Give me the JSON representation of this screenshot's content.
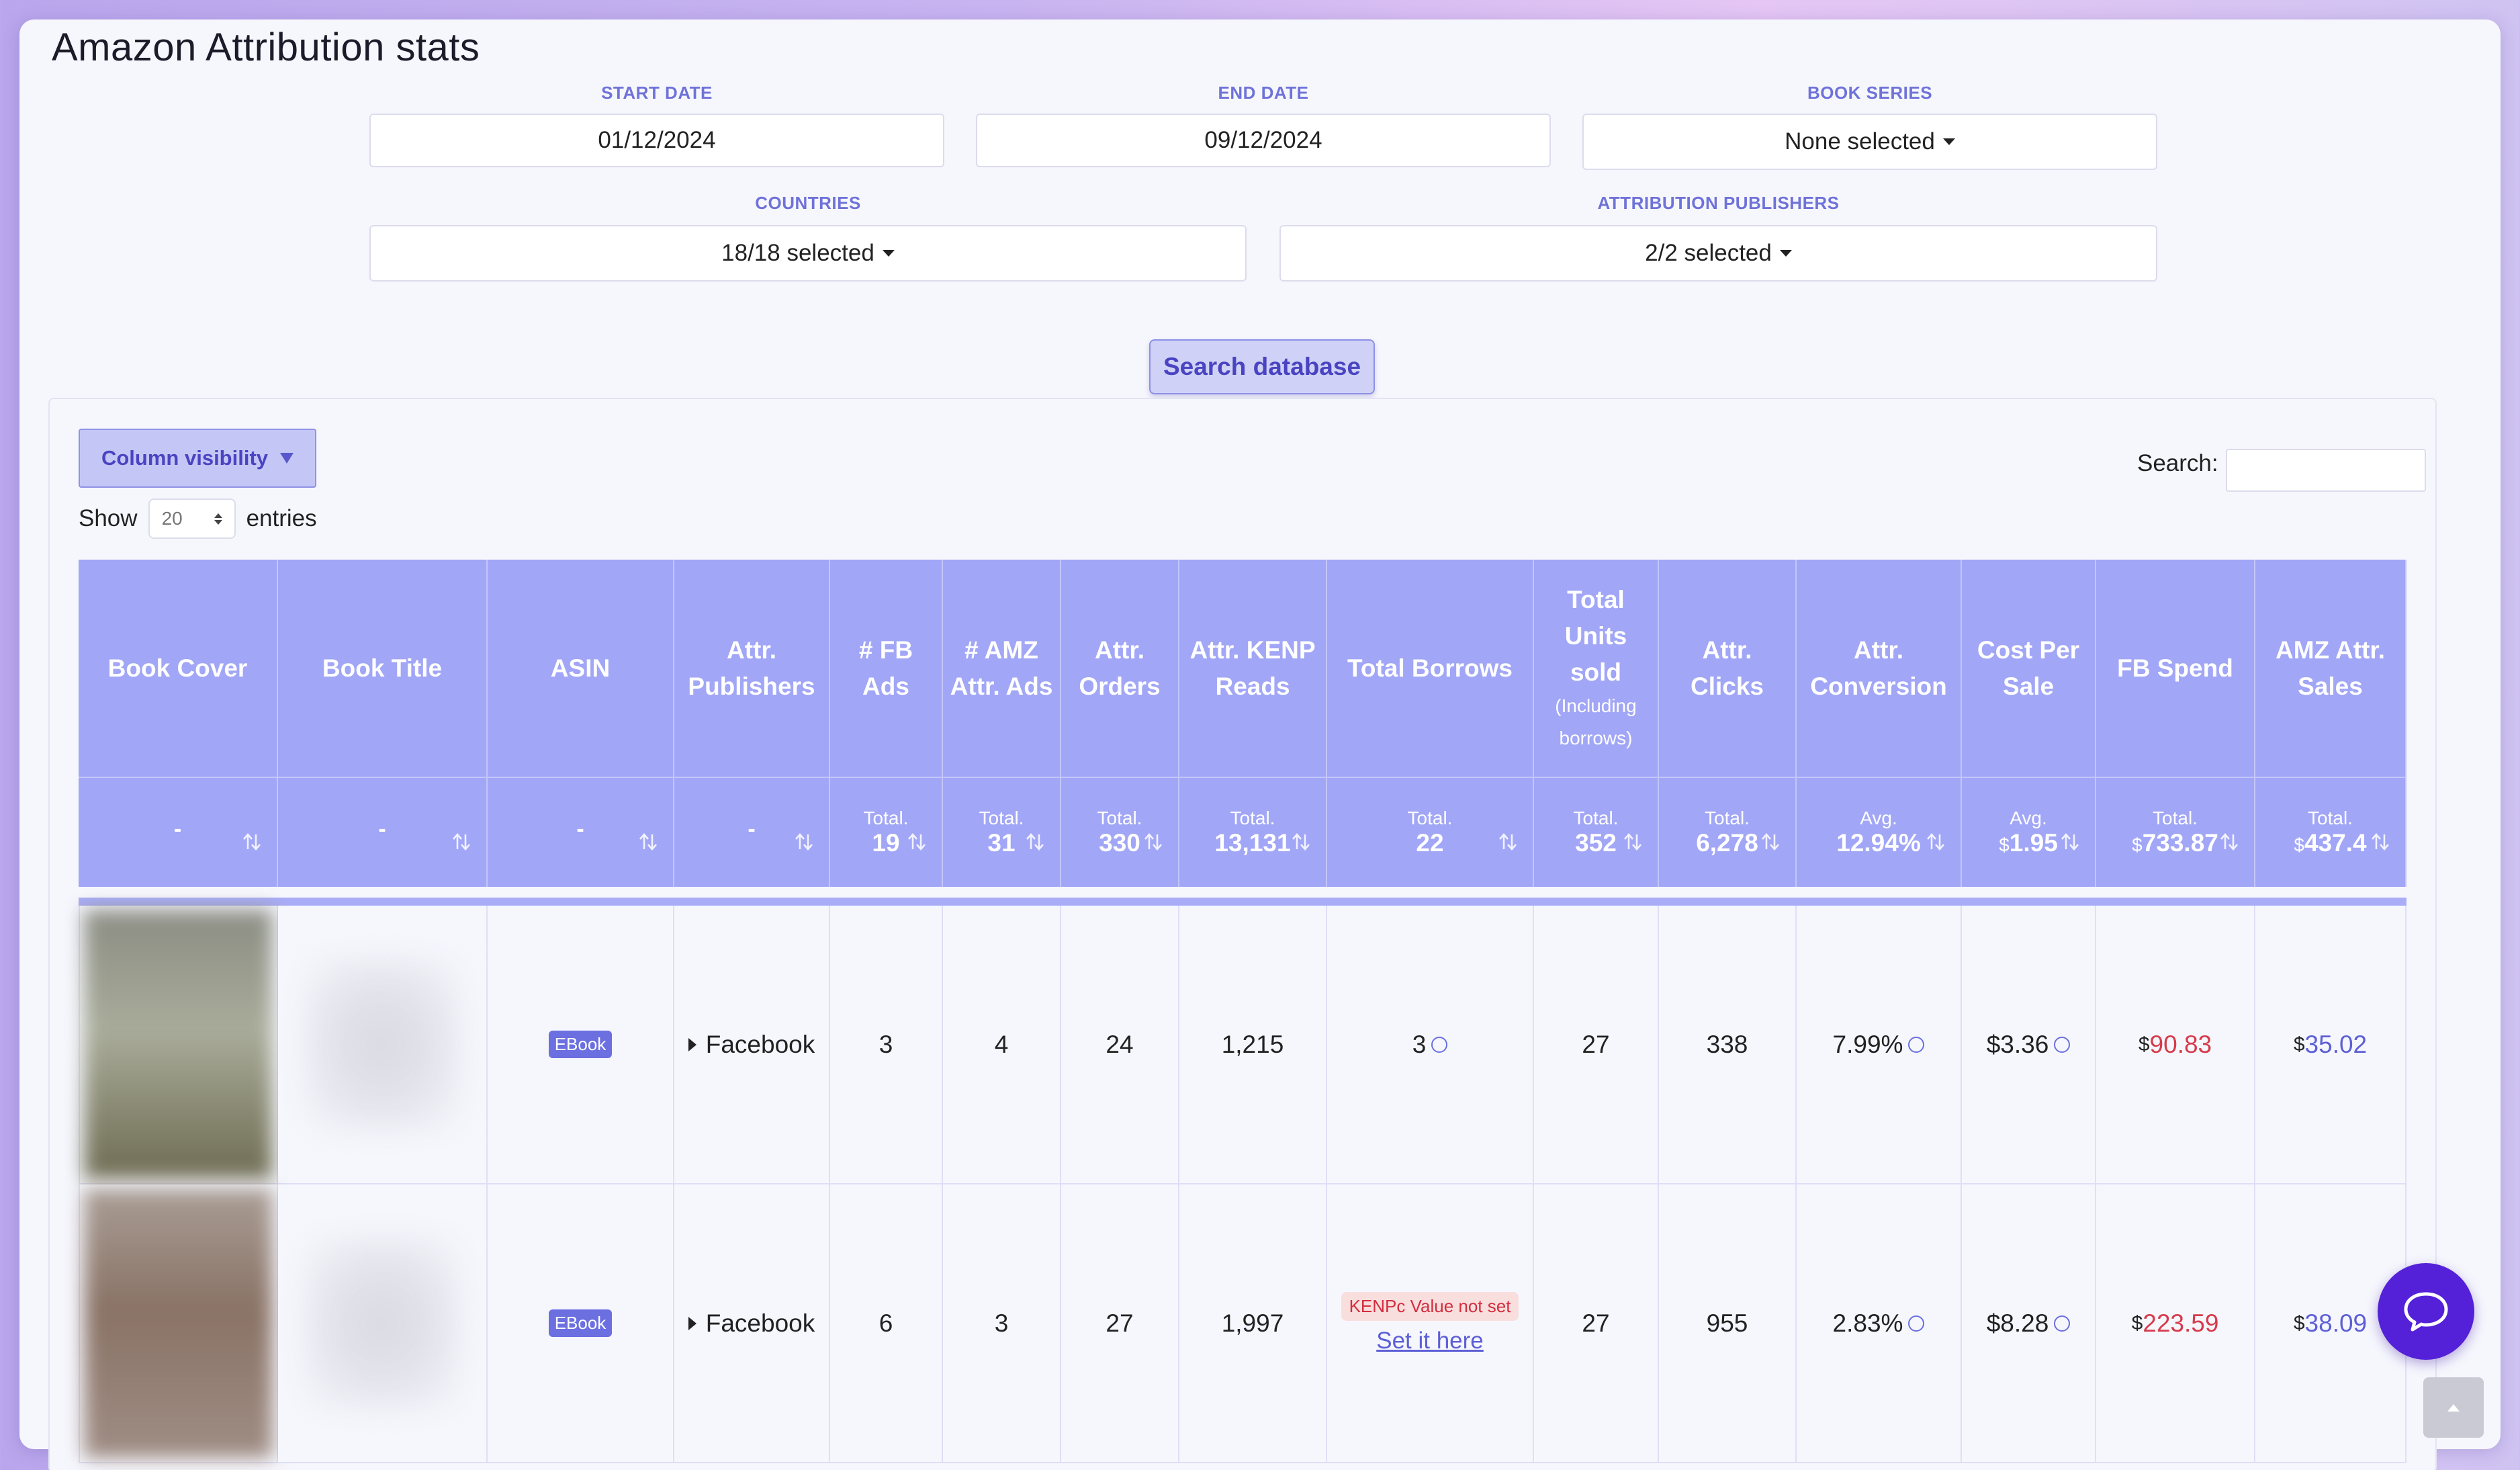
{
  "page": {
    "title": "Amazon Attribution stats"
  },
  "filters": {
    "start_date": {
      "label": "START DATE",
      "value": "01/12/2024"
    },
    "end_date": {
      "label": "END DATE",
      "value": "09/12/2024"
    },
    "book_series": {
      "label": "BOOK SERIES",
      "value": "None selected"
    },
    "countries": {
      "label": "COUNTRIES",
      "value": "18/18 selected"
    },
    "attribution_publishers": {
      "label": "ATTRIBUTION PUBLISHERS",
      "value": "2/2 selected"
    }
  },
  "search_button": {
    "label": "Search database"
  },
  "table_controls": {
    "column_visibility": "Column visibility",
    "show_label": "Show",
    "entries_value": "20",
    "entries_label": "entries",
    "search_label": "Search:",
    "search_value": ""
  },
  "columns": [
    {
      "label": "Book Cover"
    },
    {
      "label": "Book Title"
    },
    {
      "label": "ASIN"
    },
    {
      "label": "Attr. Publishers"
    },
    {
      "label": "# FB Ads"
    },
    {
      "label": "# AMZ Attr. Ads"
    },
    {
      "label": "Attr. Orders"
    },
    {
      "label": "Attr. KENP Reads"
    },
    {
      "label": "Total Borrows"
    },
    {
      "label": "Total Units sold",
      "sub": "(Including borrows)"
    },
    {
      "label": "Attr. Clicks"
    },
    {
      "label": "Attr. Conversion"
    },
    {
      "label": "Cost Per Sale"
    },
    {
      "label": "FB Spend"
    },
    {
      "label": "AMZ Attr. Sales"
    }
  ],
  "aggregates": [
    {
      "type": "dash",
      "value": "-"
    },
    {
      "type": "dash",
      "value": "-"
    },
    {
      "type": "dash",
      "value": "-"
    },
    {
      "type": "dash",
      "value": "-"
    },
    {
      "type": "agg",
      "label": "Total.",
      "value": "19"
    },
    {
      "type": "agg",
      "label": "Total.",
      "value": "31"
    },
    {
      "type": "agg",
      "label": "Total.",
      "value": "330"
    },
    {
      "type": "agg",
      "label": "Total.",
      "value": "13,131"
    },
    {
      "type": "agg",
      "label": "Total.",
      "value": "22"
    },
    {
      "type": "agg",
      "label": "Total.",
      "value": "352"
    },
    {
      "type": "agg",
      "label": "Total.",
      "value": "6,278"
    },
    {
      "type": "agg",
      "label": "Avg.",
      "value": "12.94%"
    },
    {
      "type": "agg",
      "label": "Avg.",
      "prefix": "$",
      "value": "1.95"
    },
    {
      "type": "agg",
      "label": "Total.",
      "prefix": "$",
      "value": "733.87"
    },
    {
      "type": "agg",
      "label": "Total.",
      "prefix": "$",
      "value": "437.4"
    }
  ],
  "rows": [
    {
      "asin_badge": "EBook",
      "publisher": "Facebook",
      "fb_ads": "3",
      "amz_ads": "4",
      "orders": "24",
      "kenp": "1,215",
      "borrows": "3",
      "units": "27",
      "clicks": "338",
      "conversion": "7.99%",
      "cost_per_sale": "$3.36",
      "fb_spend_prefix": "$",
      "fb_spend": "90.83",
      "amz_sales_prefix": "$",
      "amz_sales": "35.02",
      "cover_colors": [
        "#8c8d84",
        "#a9ac9a",
        "#6e6c52"
      ]
    },
    {
      "asin_badge": "EBook",
      "publisher": "Facebook",
      "fb_ads": "6",
      "amz_ads": "3",
      "orders": "27",
      "kenp": "1,997",
      "borrows_warning": "KENPc Value not set",
      "borrows_link": "Set it here",
      "units": "27",
      "clicks": "955",
      "conversion": "2.83%",
      "cost_per_sale": "$8.28",
      "fb_spend_prefix": "$",
      "fb_spend": "223.59",
      "amz_sales_prefix": "$",
      "amz_sales": "38.09",
      "cover_colors": [
        "#a99d95",
        "#8a7366",
        "#9f8d84"
      ]
    }
  ],
  "icons": {
    "chat": "chat-bubble-icon",
    "scroll_top": "chevron-up-icon",
    "help": "question-circle-icon"
  }
}
